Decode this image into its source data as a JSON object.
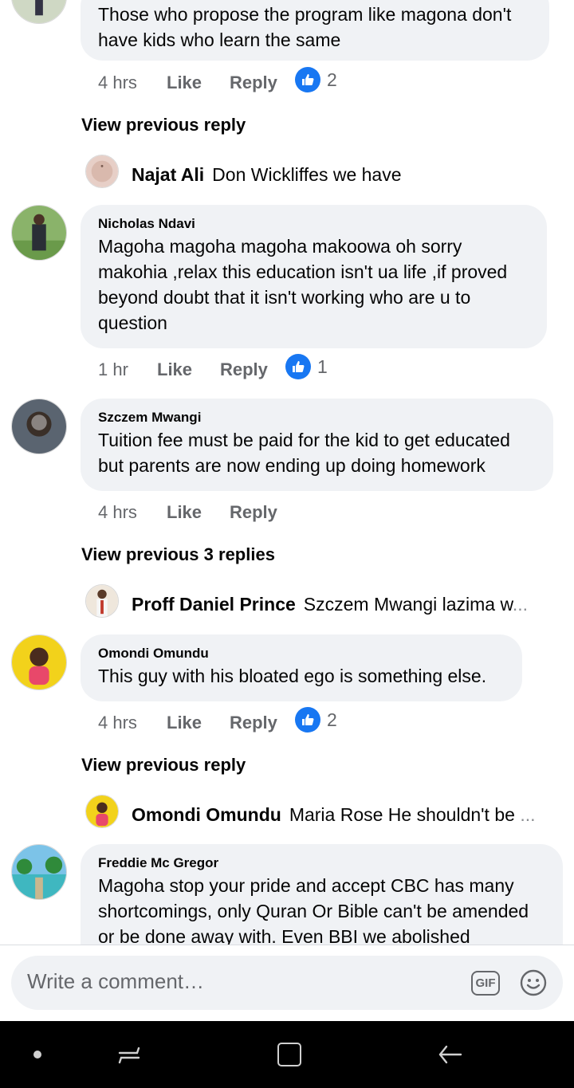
{
  "comments": [
    {
      "author": "",
      "text": "Those who propose the program like magona don't have kids who learn the same",
      "time": "4 hrs",
      "like": "Like",
      "reply": "Reply",
      "reactions": "2"
    },
    {
      "author": "Nicholas Ndavi",
      "text": "Magoha magoha magoha makoowa oh sorry makohia ,relax this education isn't ua life ,if proved beyond doubt that it isn't working who are u to question",
      "time": "1 hr",
      "like": "Like",
      "reply": "Reply",
      "reactions": "1"
    },
    {
      "author": "Szczem Mwangi",
      "text": "Tuition fee must be paid for the kid to get educated but parents are now ending up doing homework",
      "time": "4 hrs",
      "like": "Like",
      "reply": "Reply"
    },
    {
      "author": "Omondi Omundu",
      "text": "This guy with his bloated ego is something else.",
      "time": "4 hrs",
      "like": "Like",
      "reply": "Reply",
      "reactions": "2"
    },
    {
      "author": "Freddie Mc Gregor",
      "text": "Magoha stop your pride and accept CBC has many shortcomings, only Quran Or Bible can't be amended or be done away with. Even BBI we abolished"
    }
  ],
  "view_previous": [
    "View previous reply",
    "View previous 3 replies",
    "View previous reply"
  ],
  "replies": [
    {
      "author": "Najat Ali",
      "text": "Don Wickliffes we have",
      "ellipsis": ""
    },
    {
      "author": "Proff Daniel Prince",
      "text": "Szczem Mwangi lazima w",
      "ellipsis": "..."
    },
    {
      "author": "Omondi Omundu",
      "text": "Maria Rose He shouldn't be",
      "ellipsis": "..."
    }
  ],
  "composer": {
    "placeholder": "Write a comment…",
    "gif_label": "GIF"
  },
  "colors": {
    "bubble": "#f0f2f5",
    "like_blue": "#1877f2",
    "meta_gray": "#65676b",
    "navbar": "#000000"
  },
  "icons": [
    "like-reaction-icon",
    "gif-icon",
    "emoji-icon",
    "home-dot-icon",
    "recents-icon",
    "overview-icon",
    "back-icon"
  ]
}
